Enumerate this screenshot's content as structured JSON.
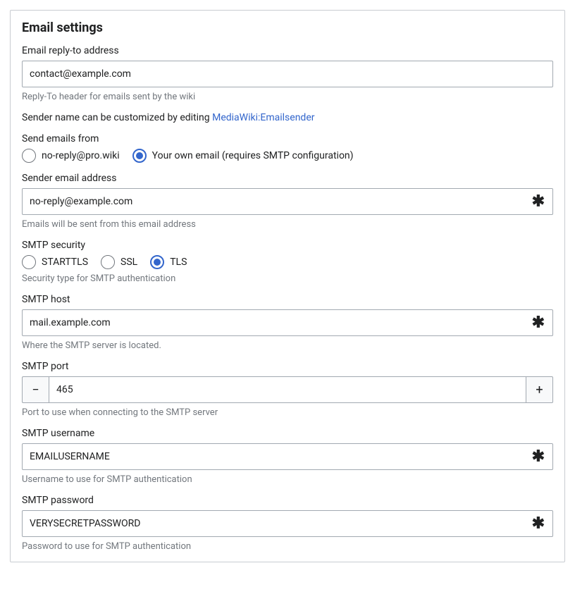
{
  "panel": {
    "title": "Email settings"
  },
  "replyTo": {
    "label": "Email reply-to address",
    "value": "contact@example.com",
    "help": "Reply-To header for emails sent by the wiki"
  },
  "senderNote": {
    "prefix": "Sender name can be customized by editing ",
    "linkText": "MediaWiki:Emailsender"
  },
  "sendFrom": {
    "label": "Send emails from",
    "option1": "no-reply@pro.wiki",
    "option2": "Your own email (requires SMTP configuration)"
  },
  "senderEmail": {
    "label": "Sender email address",
    "value": "no-reply@example.com",
    "help": "Emails will be sent from this email address"
  },
  "smtpSecurity": {
    "label": "SMTP security",
    "opt1": "STARTTLS",
    "opt2": "SSL",
    "opt3": "TLS",
    "help": "Security type for SMTP authentication"
  },
  "smtpHost": {
    "label": "SMTP host",
    "value": "mail.example.com",
    "help": "Where the SMTP server is located."
  },
  "smtpPort": {
    "label": "SMTP port",
    "value": "465",
    "help": "Port to use when connecting to the SMTP server"
  },
  "smtpUser": {
    "label": "SMTP username",
    "value": "EMAILUSERNAME",
    "help": "Username to use for SMTP authentication"
  },
  "smtpPass": {
    "label": "SMTP password",
    "value": "VERYSECRETPASSWORD",
    "help": "Password to use for SMTP authentication"
  },
  "glyphs": {
    "minus": "−",
    "plus": "+",
    "asterisk": "✱"
  }
}
